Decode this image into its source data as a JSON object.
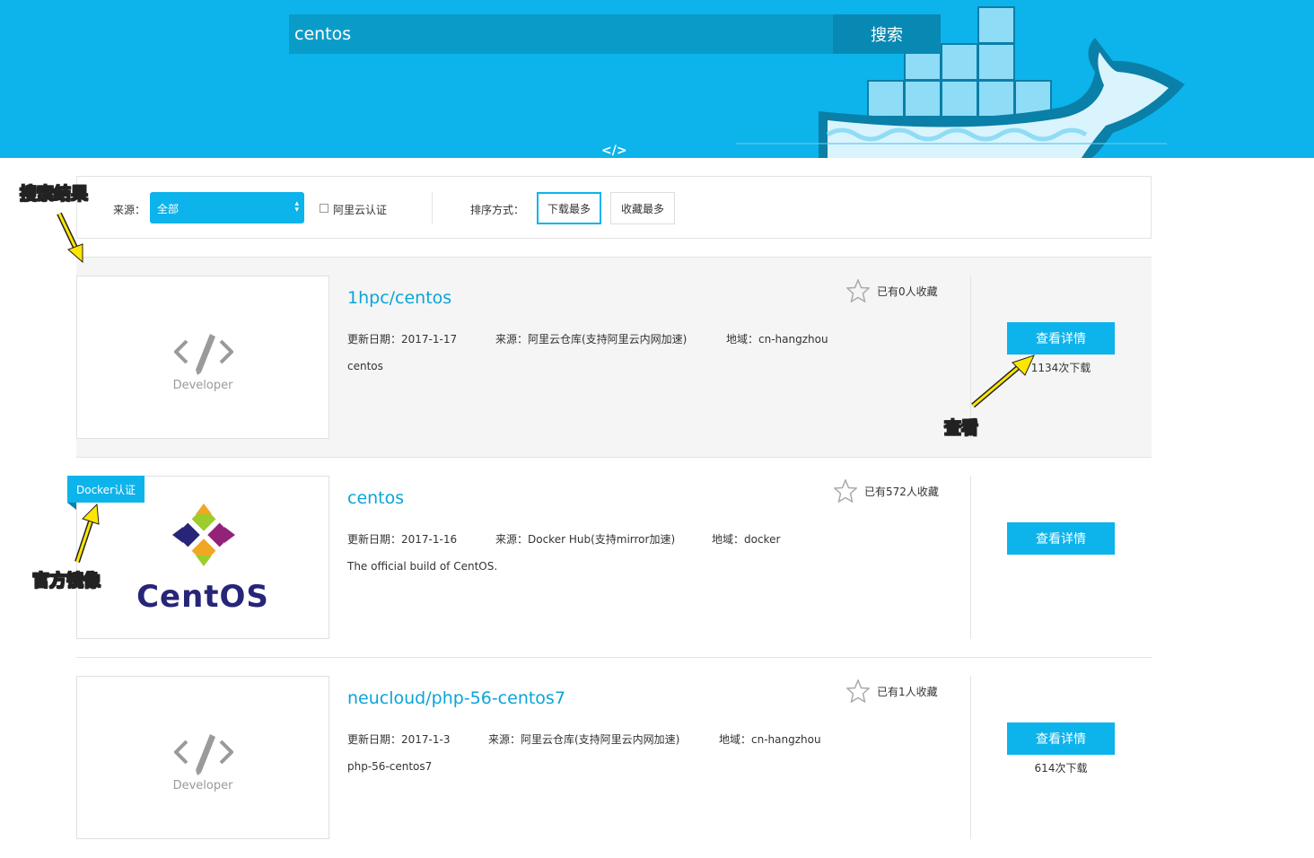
{
  "search": {
    "value": "centos",
    "button_label": "搜索"
  },
  "banner": {
    "logo_glyph": "</>"
  },
  "filter": {
    "source_label": "来源：",
    "source_selected": "全部",
    "aliyun_cert_label": "阿里云认证",
    "sort_label": "排序方式：",
    "sort_options": [
      "下载最多",
      "收藏最多"
    ],
    "active_sort": "下载最多"
  },
  "results": [
    {
      "name": "1hpc/centos",
      "update_date": "更新日期：2017-1-17",
      "source": "来源：阿里云仓库(支持阿里云内网加速)",
      "region": "地域：cn-hangzhou",
      "description": "centos",
      "favorites": "已有0人收藏",
      "detail_label": "查看详情",
      "downloads": "1134次下载",
      "thumb_text": "Developer",
      "highlighted": true
    },
    {
      "name": "centos",
      "update_date": "更新日期：2017-1-16",
      "source": "来源：Docker Hub(支持mirror加速)",
      "region": "地域：docker",
      "description": "The official build of CentOS.",
      "favorites": "已有572人收藏",
      "detail_label": "查看详情",
      "downloads": "",
      "badge": "Docker认证",
      "logo_text": "CentOS"
    },
    {
      "name": "neucloud/php-56-centos7",
      "update_date": "更新日期：2017-1-3",
      "source": "来源：阿里云仓库(支持阿里云内网加速)",
      "region": "地域：cn-hangzhou",
      "description": "php-56-centos7",
      "favorites": "已有1人收藏",
      "detail_label": "查看详情",
      "downloads": "614次下载",
      "thumb_text": "Developer"
    }
  ],
  "annotations": {
    "search_results": "搜索结果",
    "view": "查看",
    "official_image": "官方镜像"
  },
  "colors": {
    "brand_blue": "#0db3eb",
    "annotation_yellow": "#ffe600"
  }
}
